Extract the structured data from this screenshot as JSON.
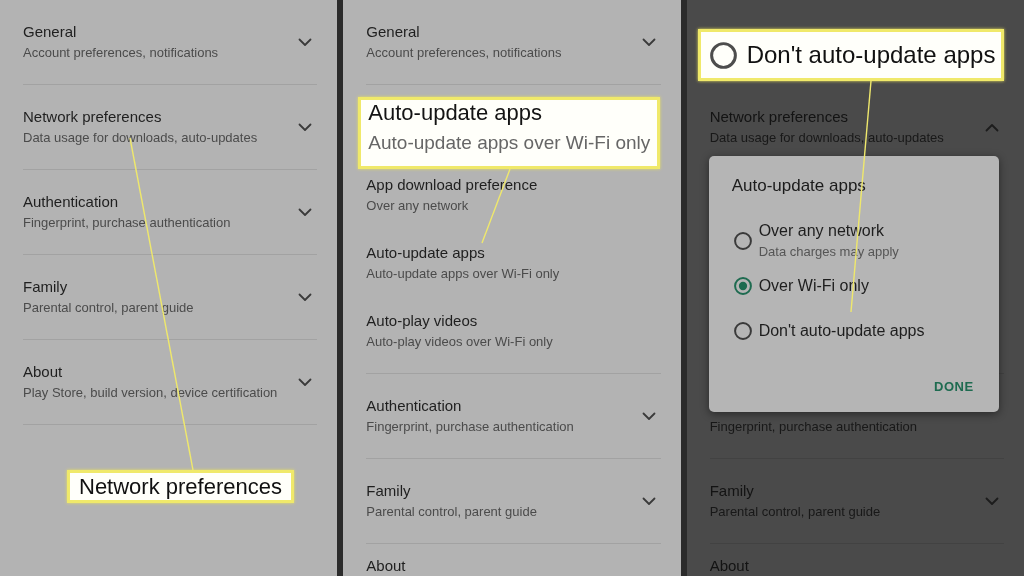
{
  "panels": [
    {
      "kind": "overview",
      "sections": [
        {
          "title": "General",
          "subtitle": "Account preferences, notifications",
          "expanded": false
        },
        {
          "title": "Network preferences",
          "subtitle": "Data usage for downloads, auto-updates",
          "expanded": false
        },
        {
          "title": "Authentication",
          "subtitle": "Fingerprint, purchase authentication",
          "expanded": false
        },
        {
          "title": "Family",
          "subtitle": "Parental control, parent guide",
          "expanded": false
        },
        {
          "title": "About",
          "subtitle": "Play Store, build version, device certification",
          "expanded": false
        }
      ],
      "callout": {
        "kind": "label",
        "title": "Network preferences"
      }
    },
    {
      "kind": "expanded",
      "sections": [
        {
          "title": "General",
          "subtitle": "Account preferences, notifications",
          "expanded": false
        },
        {
          "expanded": true,
          "children": [
            {
              "title": "App download preference",
              "subtitle": "Over any network"
            },
            {
              "title": "Auto-update apps",
              "subtitle": "Auto-update apps over Wi-Fi only"
            },
            {
              "title": "Auto-play videos",
              "subtitle": "Auto-play videos over Wi-Fi only"
            }
          ]
        },
        {
          "title": "Authentication",
          "subtitle": "Fingerprint, purchase authentication",
          "expanded": false
        },
        {
          "title": "Family",
          "subtitle": "Parental control, parent guide",
          "expanded": false
        },
        {
          "title": "About"
        }
      ],
      "callout": {
        "kind": "setting",
        "title": "Auto-update apps",
        "subtitle": "Auto-update apps over Wi-Fi only"
      }
    },
    {
      "kind": "dialog",
      "sections": [
        {
          "title": "Network preferences",
          "subtitle": "Data usage for downloads, auto-updates",
          "expanded": true
        },
        {
          "subtitle": "Fingerprint, purchase authentication"
        },
        {
          "title": "Family",
          "subtitle": "Parental control, parent guide",
          "expanded": false
        },
        {
          "title": "About"
        }
      ],
      "dialog": {
        "title": "Auto-update apps",
        "options": [
          {
            "label": "Over any network",
            "note": "Data charges may apply",
            "selected": false
          },
          {
            "label": "Over Wi-Fi only",
            "selected": true
          },
          {
            "label": "Don't auto-update apps",
            "selected": false
          }
        ],
        "button": "DONE"
      },
      "callout": {
        "kind": "option",
        "label": "Don't auto-update apps",
        "selected": false
      }
    }
  ]
}
